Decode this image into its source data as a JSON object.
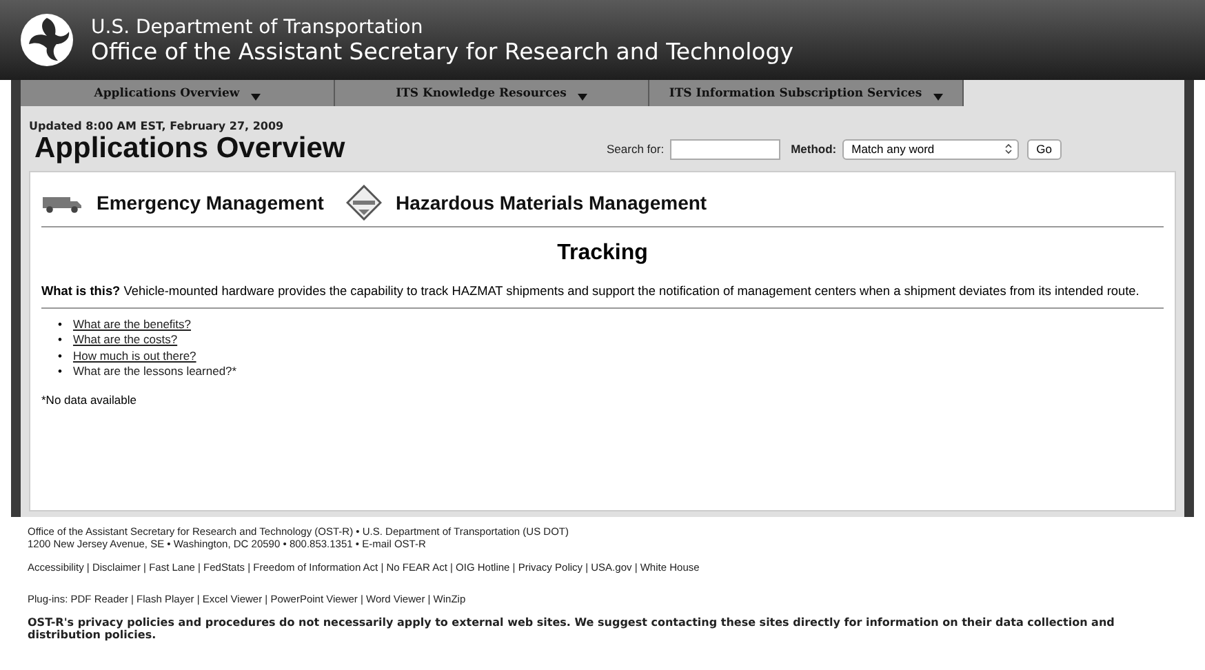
{
  "header": {
    "agency": "U.S. Department of Transportation",
    "office": "Office of the Assistant Secretary for Research and Technology"
  },
  "nav": [
    {
      "label": "Applications Overview"
    },
    {
      "label": "ITS Knowledge Resources"
    },
    {
      "label": "ITS Information Subscription Services"
    }
  ],
  "updated": "Updated 8:00 AM EST, February 27, 2009",
  "page_title": "Applications Overview",
  "search": {
    "label": "Search for:",
    "method_label": "Method:",
    "method_value": "Match any word",
    "button": "Go"
  },
  "categories": [
    {
      "label": "Emergency Management",
      "kind": "truck"
    },
    {
      "label": "Hazardous Materials Management",
      "kind": "hazmat"
    }
  ],
  "section_title": "Tracking",
  "description": "**What is this?** Vehicle-mounted hardware provides the capability to track HAZMAT shipments and support the notification of management centers when a shipment deviates from its intended route.",
  "questions": [
    {
      "bullet": "•",
      "label": "What are the benefits?",
      "link": true
    },
    {
      "bullet": "•",
      "label": "What are the costs?",
      "link": true
    },
    {
      "bullet": "•",
      "label": "How much is out there?",
      "link": true
    },
    {
      "bullet": "•",
      "label": "What are the lessons learned?*",
      "link": false
    }
  ],
  "note": "*No data available",
  "footer": {
    "address": [
      "Office of the Assistant Secretary for Research and Technology (OST-R) • U.S. Department of Transportation (US DOT)",
      "1200 New Jersey Avenue, SE • Washington, DC 20590 • 800.853.1351 • E-mail OST-R"
    ],
    "links": "Accessibility | Disclaimer | Fast Lane | FedStats | Freedom of Information Act | No FEAR Act | OIG Hotline | Privacy Policy | USA.gov | White House",
    "plugins": "Plug-ins: PDF Reader | Flash Player | Excel Viewer | PowerPoint Viewer | Word Viewer | WinZip",
    "disclaimer": "OST-R's privacy policies and procedures do not necessarily apply to external web sites. We suggest contacting these sites directly for information on their data collection and distribution policies."
  }
}
